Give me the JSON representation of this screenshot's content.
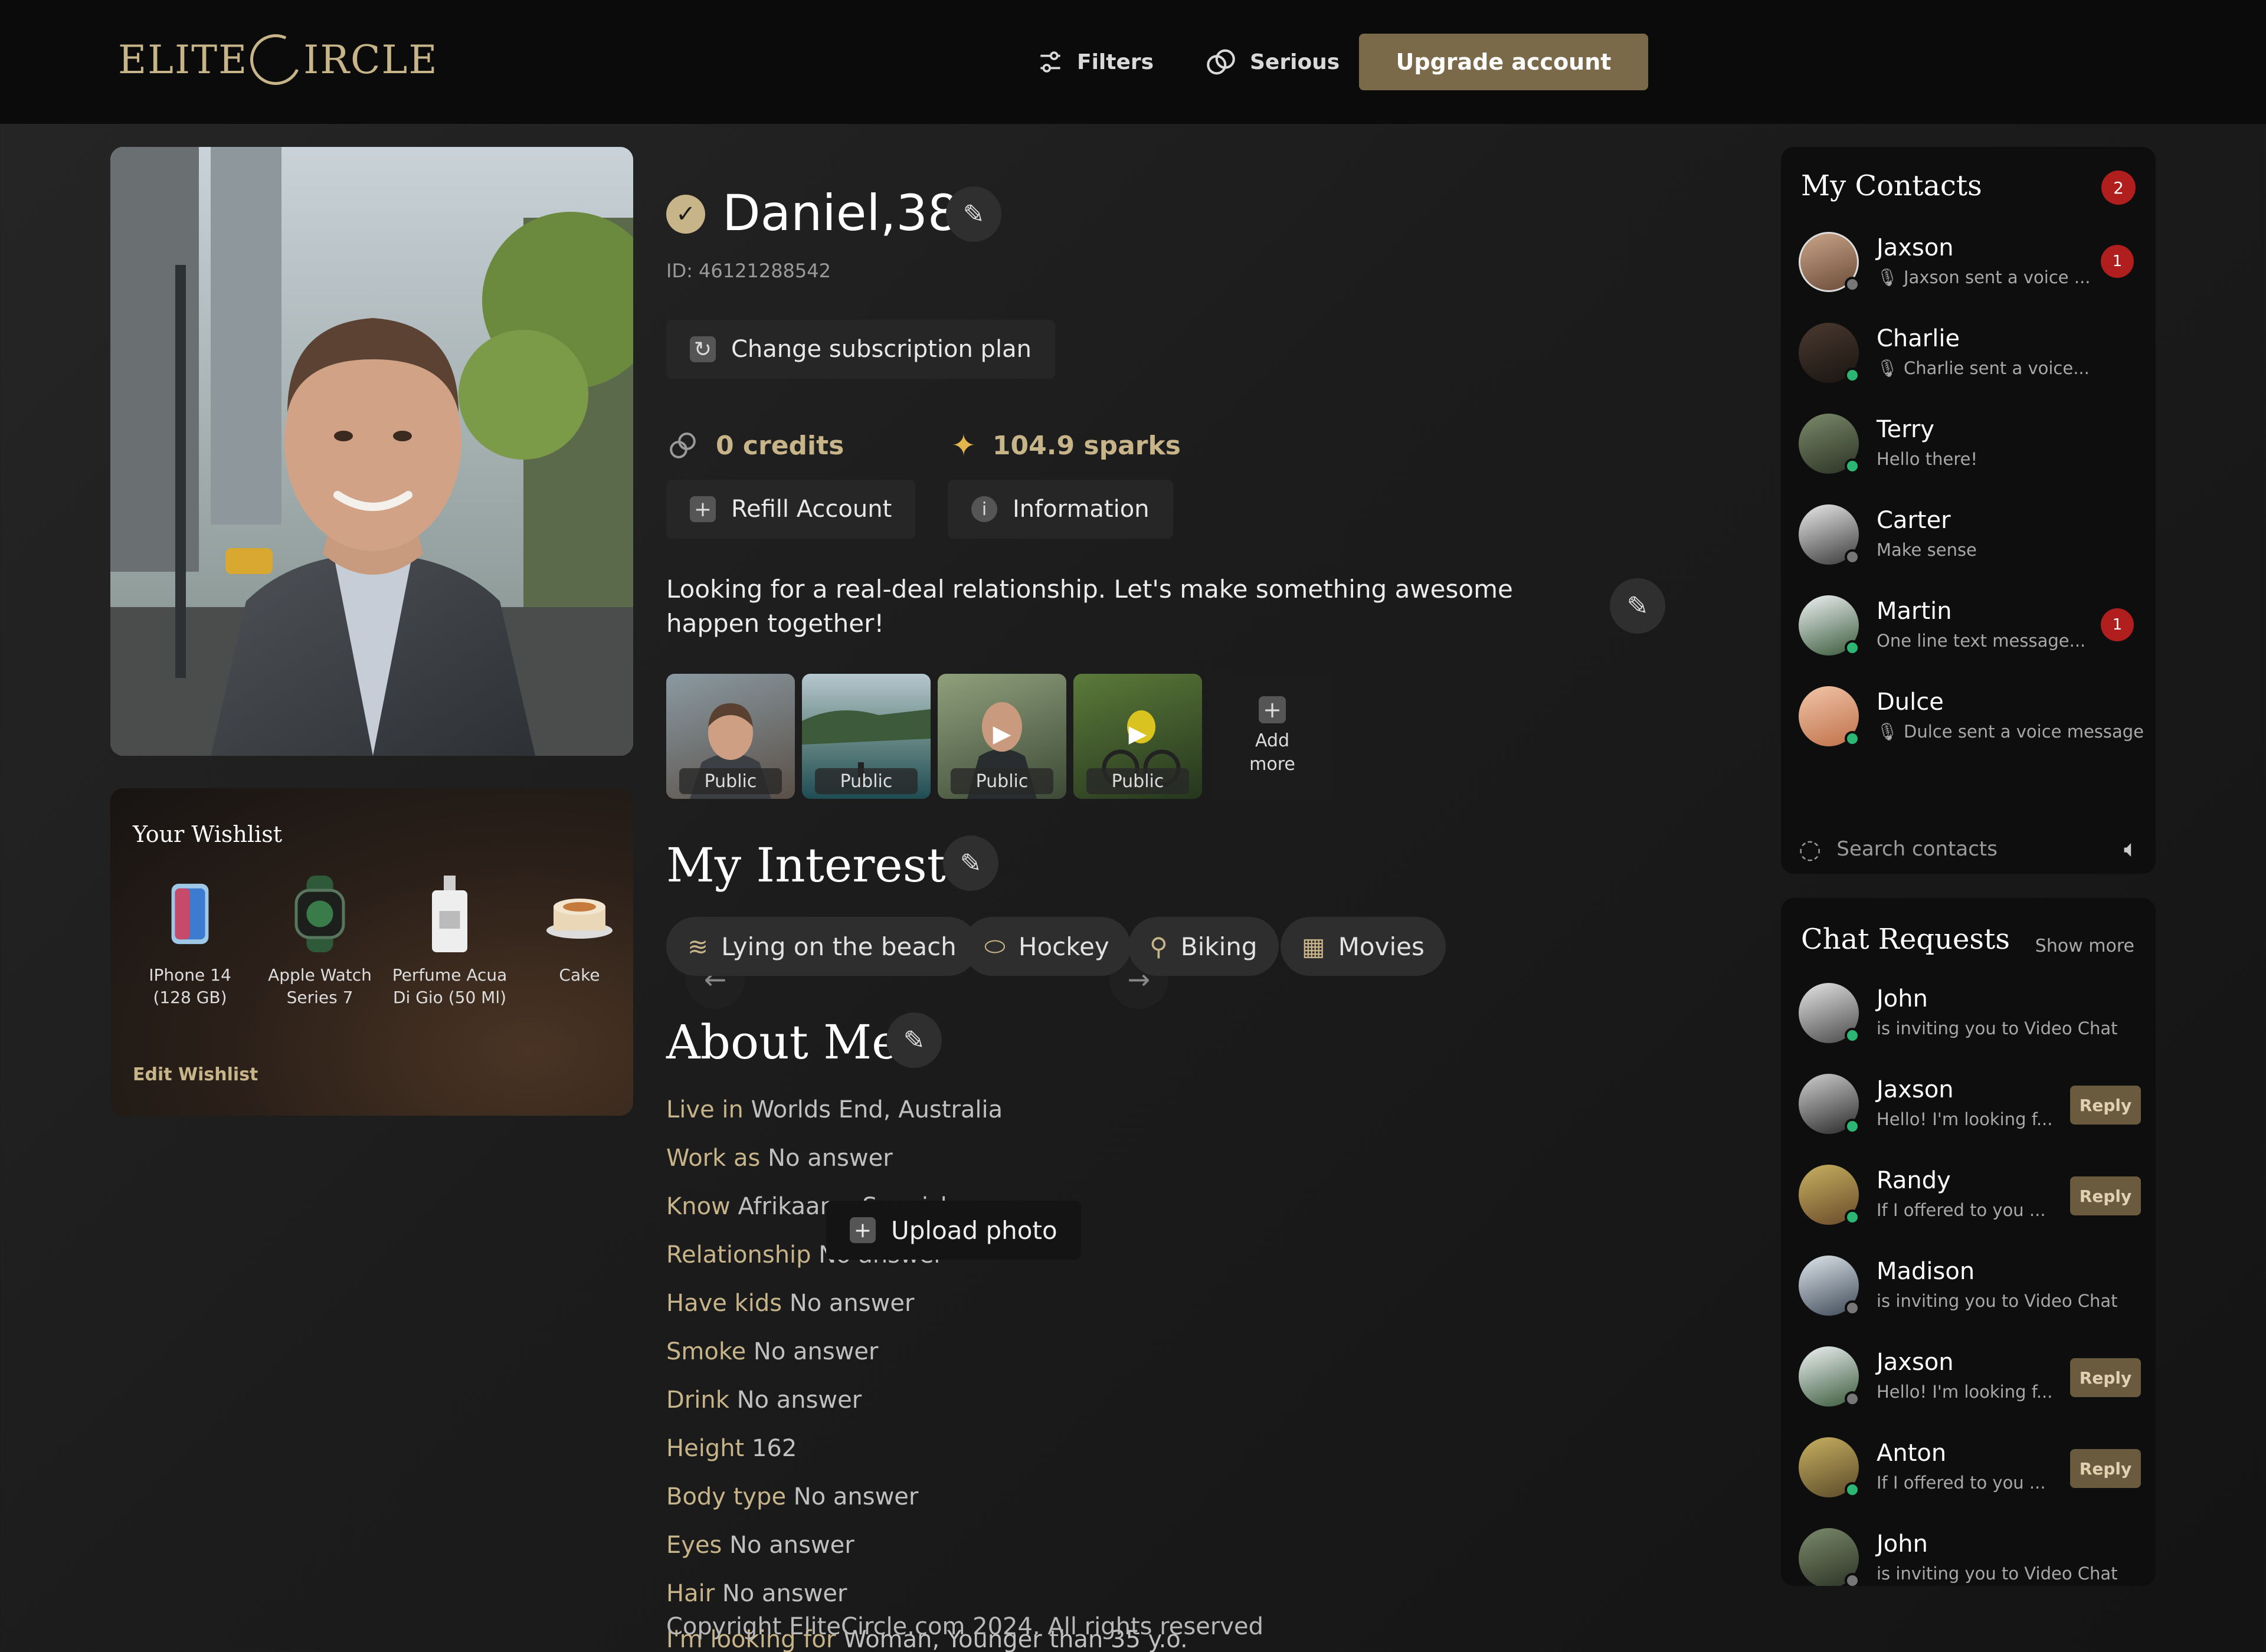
{
  "brand": {
    "logo_left": "ELITE",
    "logo_right": "IRCLE"
  },
  "nav": {
    "filters": "Filters",
    "serious": "Serious",
    "upgrade": "Upgrade account"
  },
  "profile": {
    "name": "Daniel,38",
    "id": "ID: 46121288542",
    "change_plan": "Change subscription plan",
    "credits": "0 credits",
    "sparks": "104.9 sparks",
    "refill": "Refill Account",
    "information": "Information",
    "bio": "Looking for a real-deal relationship. Let's make something awesome happen together!",
    "photos": [
      {
        "tag": "Public"
      },
      {
        "tag": "Public"
      },
      {
        "tag": "Public"
      },
      {
        "tag": "Public"
      }
    ],
    "add_more": "Add more"
  },
  "wishlist": {
    "title": "Your Wishlist",
    "items": [
      {
        "label": "IPhone 14 (128 GB)"
      },
      {
        "label": "Apple Watch Series 7"
      },
      {
        "label": "Perfume Acua Di Gio (50 Ml)"
      },
      {
        "label": "Cake"
      }
    ],
    "edit": "Edit Wishlist"
  },
  "interests": {
    "title": "My Interests",
    "items": [
      "Lying on the beach",
      "Hockey",
      "Biking",
      "Movies"
    ]
  },
  "about": {
    "title": "About Me",
    "rows": [
      {
        "k": "Live in",
        "v": "Worlds End, Australia"
      },
      {
        "k": "Work as",
        "v": "No answer"
      },
      {
        "k": "Know",
        "v": "Afrikaans, Spanish"
      },
      {
        "k": "Relationship",
        "v": "No answer"
      },
      {
        "k": "Have kids",
        "v": "No answer"
      },
      {
        "k": "Smoke",
        "v": "No answer"
      },
      {
        "k": "Drink",
        "v": "No answer"
      },
      {
        "k": "Height",
        "v": "162"
      },
      {
        "k": "Body type",
        "v": "No answer"
      },
      {
        "k": "Eyes",
        "v": "No answer"
      },
      {
        "k": "Hair",
        "v": "No answer"
      },
      {
        "k": "I'm looking for",
        "v": "Woman, Younger than 35 y.o."
      }
    ],
    "upload": "Upload photo"
  },
  "footer": {
    "copyright": "Copyright EliteCircle.com 2024. All rights reserved"
  },
  "contacts": {
    "title": "My Contacts",
    "count": "2",
    "items": [
      {
        "name": "Jaxson",
        "msg": "Jaxson sent a voice ...",
        "badge": "1"
      },
      {
        "name": "Charlie",
        "msg": "Charlie sent a voice..."
      },
      {
        "name": "Terry",
        "msg": "Hello there!"
      },
      {
        "name": "Carter",
        "msg": "Make sense"
      },
      {
        "name": "Martin",
        "msg": "One line text message...",
        "badge": "1"
      },
      {
        "name": "Dulce",
        "msg": "Dulce sent a voice message"
      }
    ],
    "search_placeholder": "Search contacts"
  },
  "requests": {
    "title": "Chat Requests",
    "show_more": "Show more",
    "reply": "Reply",
    "items": [
      {
        "name": "John",
        "msg": "is inviting you to Video Chat"
      },
      {
        "name": "Jaxson",
        "msg": "Hello! I'm looking f..."
      },
      {
        "name": "Randy",
        "msg": "If I offered to you ..."
      },
      {
        "name": "Madison",
        "msg": "is inviting you to Video Chat"
      },
      {
        "name": "Jaxson",
        "msg": "Hello! I'm looking f..."
      },
      {
        "name": "Anton",
        "msg": "If I offered to you ..."
      },
      {
        "name": "John",
        "msg": "is inviting you to Video Chat"
      }
    ]
  },
  "colors": {
    "accent": "#c8b489",
    "button": "#7a6a49",
    "online": "#2bb673",
    "badge": "#b01e1e"
  }
}
